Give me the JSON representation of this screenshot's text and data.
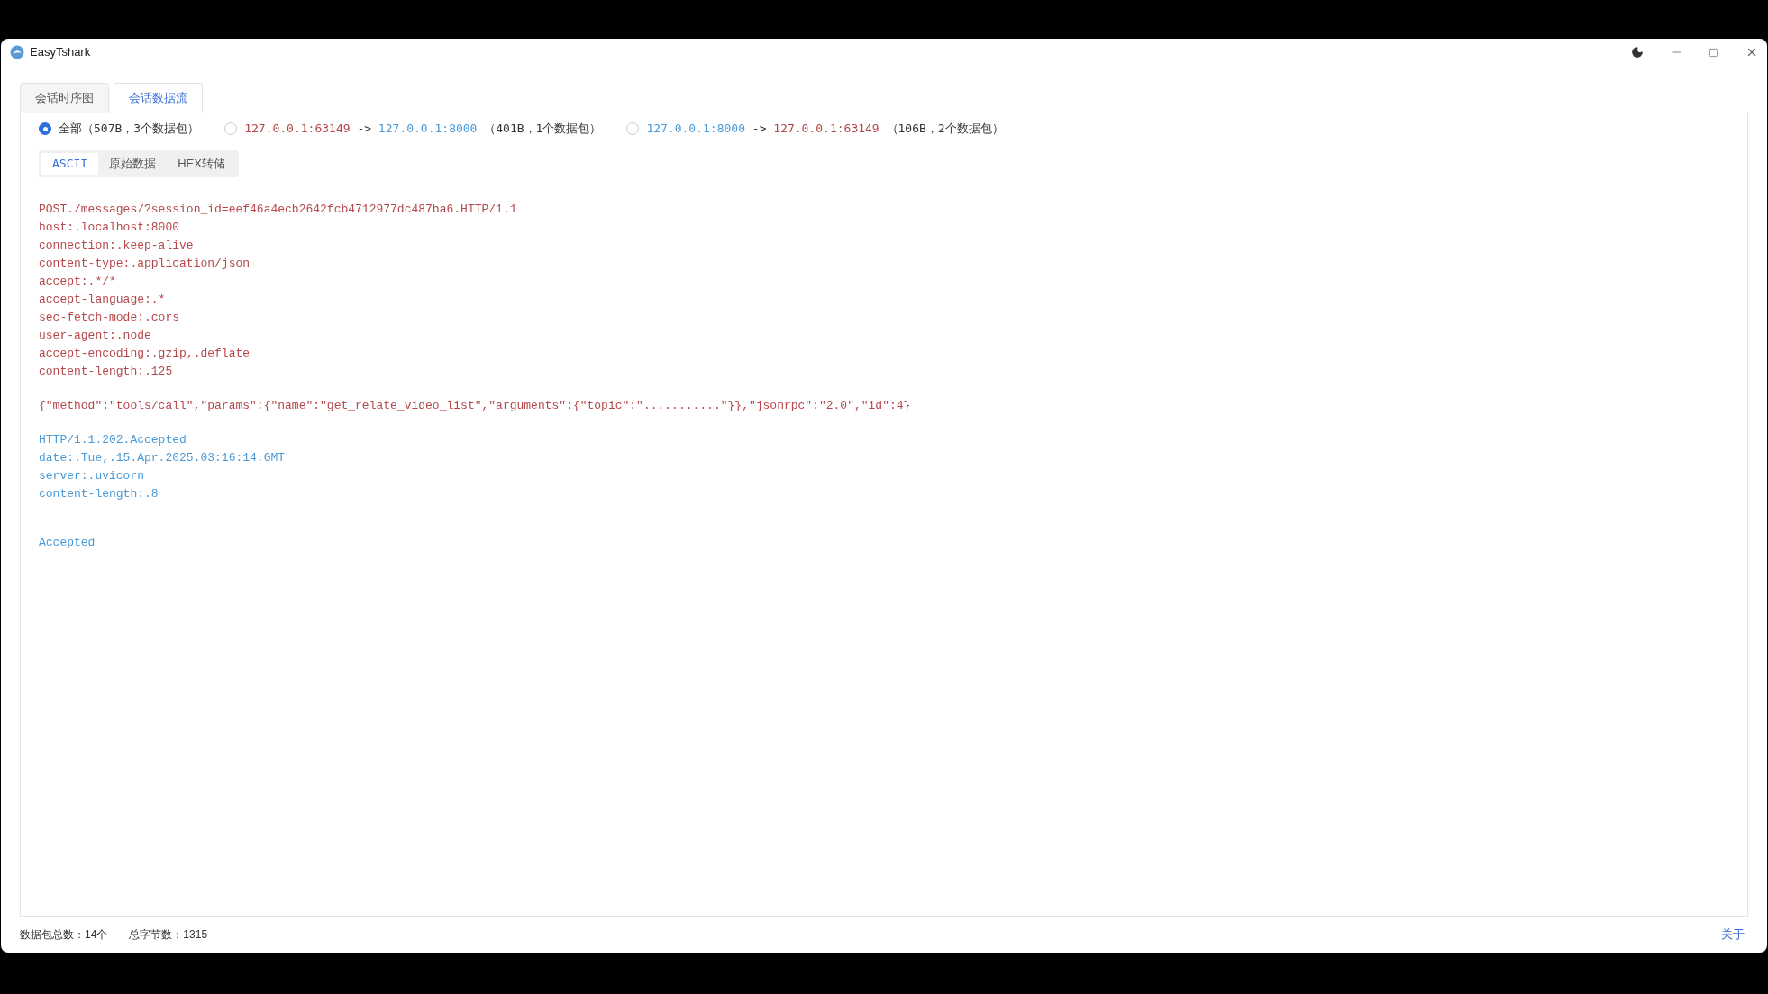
{
  "window": {
    "title": "EasyTshark"
  },
  "tabs": [
    {
      "label": "会话时序图",
      "selected": false
    },
    {
      "label": "会话数据流",
      "selected": true
    }
  ],
  "streams": [
    {
      "kind": "all",
      "label": "全部（507B，3个数据包）",
      "selected": true
    },
    {
      "kind": "flow",
      "src": {
        "text": "127.0.0.1:63149",
        "color": "#b5474a"
      },
      "arrow": "->",
      "dst": {
        "text": "127.0.0.1:8000",
        "color": "#4a9ad8"
      },
      "info": "（401B，1个数据包）",
      "selected": false
    },
    {
      "kind": "flow",
      "src": {
        "text": "127.0.0.1:8000",
        "color": "#4a9ad8"
      },
      "arrow": "->",
      "dst": {
        "text": "127.0.0.1:63149",
        "color": "#b5474a"
      },
      "info": "（106B，2个数据包）",
      "selected": false
    }
  ],
  "view_tabs": [
    {
      "label": "ASCII",
      "selected": true
    },
    {
      "label": "原始数据",
      "selected": false
    },
    {
      "label": "HEX转储",
      "selected": false
    }
  ],
  "blocks": [
    {
      "kind": "request_headers",
      "color": "#b5474a",
      "lines": [
        "POST./messages/?session_id=eef46a4ecb2642fcb4712977dc487ba6.HTTP/1.1",
        "host:.localhost:8000",
        "connection:.keep-alive",
        "content-type:.application/json",
        "accept:.*/*",
        "accept-language:.*",
        "sec-fetch-mode:.cors",
        "user-agent:.node",
        "accept-encoding:.gzip,.deflate",
        "content-length:.125"
      ]
    },
    {
      "kind": "request_body",
      "color": "#b5474a",
      "lines": [
        "{\"method\":\"tools/call\",\"params\":{\"name\":\"get_relate_video_list\",\"arguments\":{\"topic\":\"...........\"}},\"jsonrpc\":\"2.0\",\"id\":4}"
      ]
    },
    {
      "kind": "response_headers",
      "color": "#4a9ad8",
      "lines": [
        "HTTP/1.1.202.Accepted",
        "date:.Tue,.15.Apr.2025.03:16:14.GMT",
        "server:.uvicorn",
        "content-length:.8"
      ]
    },
    {
      "kind": "response_body",
      "color": "#4a9ad8",
      "lines": [
        "Accepted"
      ]
    }
  ],
  "status_bar": {
    "packets": "数据包总数：14个",
    "bytes": "总字节数：1315",
    "about": "关于"
  }
}
